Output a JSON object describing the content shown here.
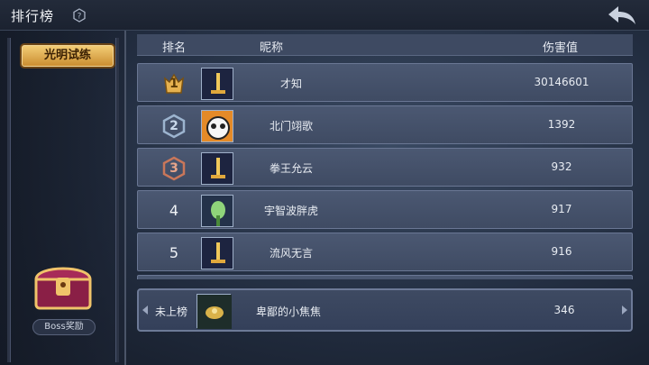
{
  "header": {
    "title": "排行榜",
    "help_icon": "question-icon",
    "back_icon": "back-arrow-icon"
  },
  "sidebar": {
    "tab_label": "光明试练",
    "reward_label": "Boss奖励",
    "reward_icon": "treasure-chest-icon"
  },
  "table": {
    "columns": [
      "排名",
      "昵称",
      "伤害值"
    ],
    "rows": [
      {
        "rank": "1",
        "name": "才知",
        "damage": "30146601",
        "avatar": "sword-avatar"
      },
      {
        "rank": "2",
        "name": "北门翊歌",
        "damage": "1392",
        "avatar": "panda-avatar"
      },
      {
        "rank": "3",
        "name": "拳王允云",
        "damage": "932",
        "avatar": "sword-avatar"
      },
      {
        "rank": "4",
        "name": "宇智波胖虎",
        "damage": "917",
        "avatar": "plant-avatar"
      },
      {
        "rank": "5",
        "name": "流风无言",
        "damage": "916",
        "avatar": "sword-avatar"
      }
    ]
  },
  "self": {
    "rank_label": "未上榜",
    "name": "卑鄙的小焦焦",
    "damage": "346",
    "avatar": "flower-avatar"
  },
  "colors": {
    "gold": "#e6b24f",
    "silver": "#9cb4cf",
    "bronze": "#c9775a",
    "accent_tab": "#f0c466"
  }
}
